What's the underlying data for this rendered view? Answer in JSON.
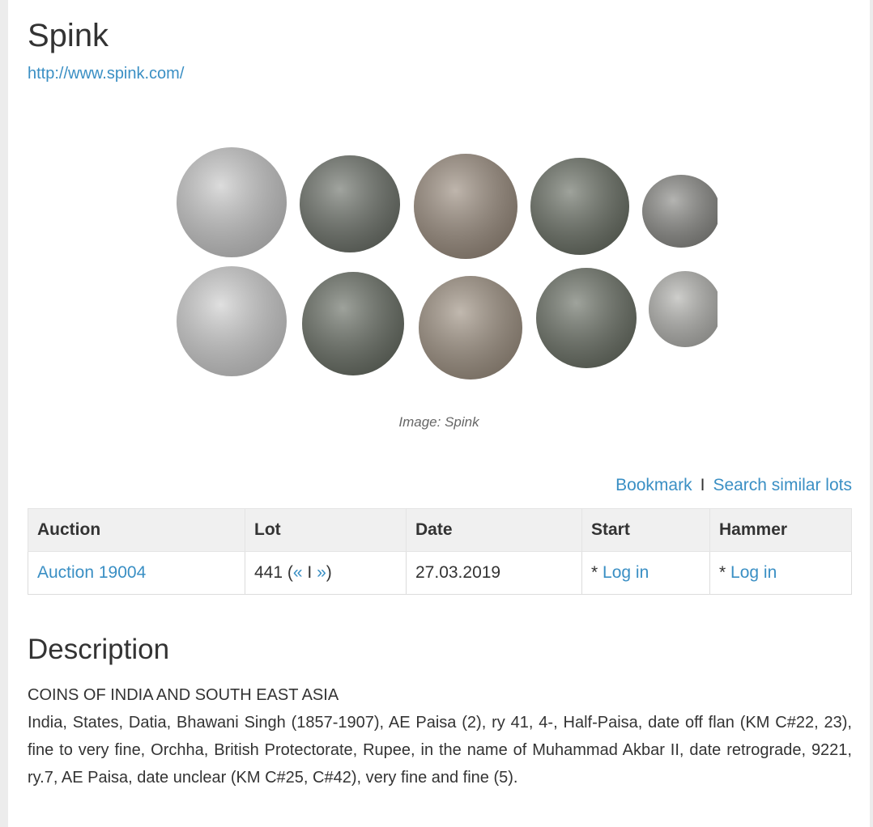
{
  "header": {
    "title": "Spink",
    "url": "http://www.spink.com/"
  },
  "image": {
    "caption": "Image: Spink",
    "coins_top": [
      "#c9c9c9",
      "#6e736b",
      "#9c8e80",
      "#6b7166",
      "#8c8c88"
    ],
    "coins_bottom": [
      "#cfcfcf",
      "#6a7066",
      "#a09384",
      "#6c7267",
      "#b4b4b0"
    ]
  },
  "actions": {
    "bookmark": "Bookmark",
    "separator": "I",
    "search_similar": "Search similar lots"
  },
  "table": {
    "headers": [
      "Auction",
      "Lot",
      "Date",
      "Start",
      "Hammer"
    ],
    "row": {
      "auction": "Auction 19004",
      "lot_number": "441",
      "lot_prev": "«",
      "lot_sep": "I",
      "lot_next": "»",
      "date": "27.03.2019",
      "start_prefix": "*",
      "start_link": "Log in",
      "hammer_prefix": "*",
      "hammer_link": "Log in"
    }
  },
  "description": {
    "heading": "Description",
    "category": "COINS OF INDIA AND SOUTH EAST ASIA",
    "text": "India, States, Datia, Bhawani Singh (1857-1907), AE Paisa (2), ry 41, 4-, Half-Paisa, date off flan (KM C#22, 23), fine to very fine, Orchha, British Protectorate, Rupee, in the name of Muhammad Akbar II, date retrograde, 9221, ry.7, AE Paisa, date unclear (KM C#25, C#42), very fine and fine (5)."
  },
  "colors": {
    "link": "#3a8fc4",
    "header_bg": "#f0f0f0",
    "text": "#333333"
  }
}
